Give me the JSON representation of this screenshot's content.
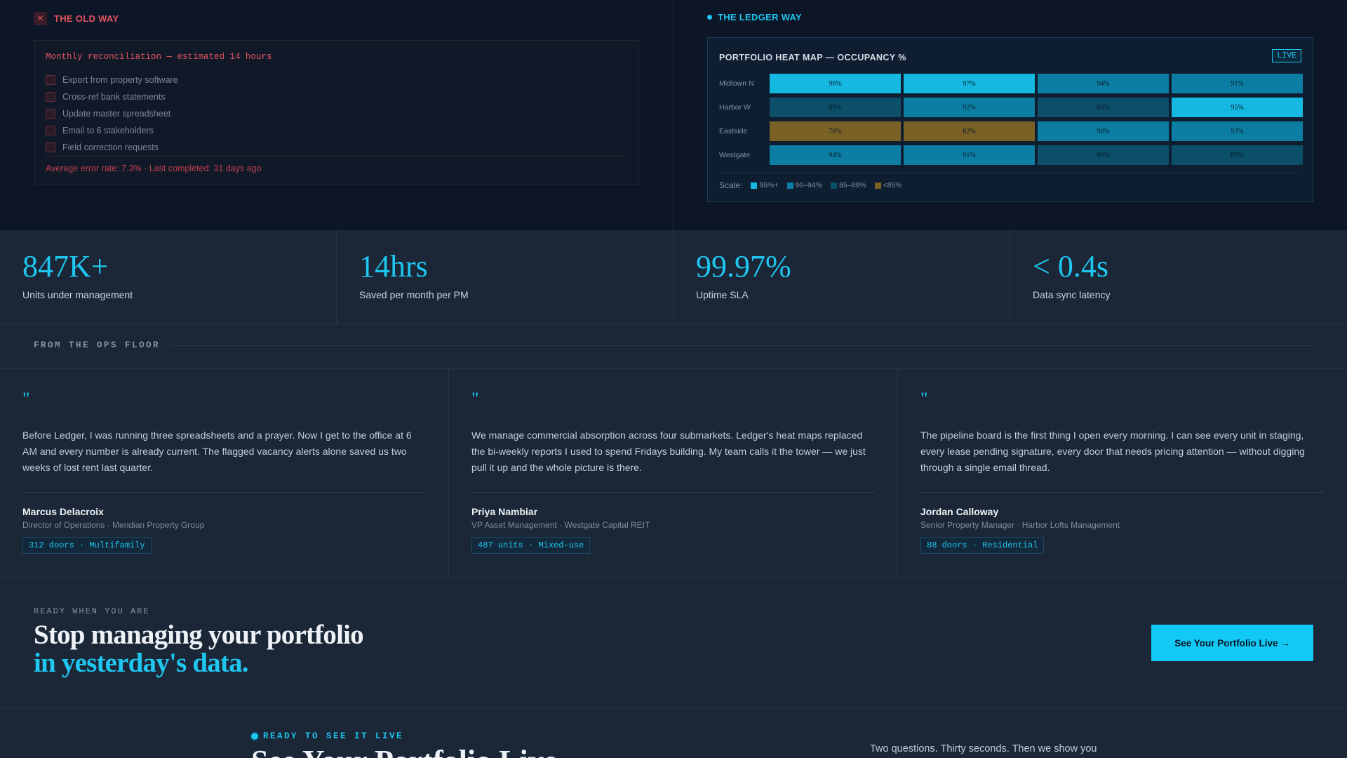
{
  "old_way": {
    "title": "THE OLD WAY",
    "heading": "Monthly reconciliation — estimated 14 hours",
    "tasks": [
      "Export from property software",
      "Cross-ref bank statements",
      "Update master spreadsheet",
      "Email to 6 stakeholders",
      "Field correction requests"
    ],
    "footer": "Average error rate: 7.3% · Last completed: 31 days ago"
  },
  "ledger_way": {
    "title": "THE LEDGER WAY",
    "heatmap_title": "PORTFOLIO HEAT MAP — OCCUPANCY %",
    "live_badge": "LIVE",
    "rows": [
      {
        "label": "Midtown N",
        "cells": [
          "96%",
          "97%",
          "94%",
          "91%"
        ]
      },
      {
        "label": "Harbor W",
        "cells": [
          "89%",
          "92%",
          "88%",
          "95%"
        ]
      },
      {
        "label": "Eastside",
        "cells": [
          "78%",
          "82%",
          "90%",
          "93%"
        ]
      },
      {
        "label": "Westgate",
        "cells": [
          "94%",
          "91%",
          "86%",
          "89%"
        ]
      }
    ],
    "scale_label": "Scale:",
    "scale": [
      {
        "label": "95%+",
        "color": "#14b8e0"
      },
      {
        "label": "90–94%",
        "color": "#0c7ea3"
      },
      {
        "label": "85–89%",
        "color": "#0b4f69"
      },
      {
        "label": "<85%",
        "color": "#7a6226"
      }
    ]
  },
  "stats": [
    {
      "value": "847K+",
      "label": "Units under management"
    },
    {
      "value": "14hrs",
      "label": "Saved per month per PM"
    },
    {
      "value": "99.97%",
      "label": "Uptime SLA"
    },
    {
      "value": "< 0.4s",
      "label": "Data sync latency"
    }
  ],
  "ops_floor": {
    "title": "FROM THE OPS FLOOR",
    "quote_mark": "\"",
    "testimonials": [
      {
        "quote": "Before Ledger, I was running three spreadsheets and a prayer. Now I get to the office at 6 AM and every number is already current. The flagged vacancy alerts alone saved us two weeks of lost rent last quarter.",
        "name": "Marcus Delacroix",
        "role": "Director of Operations · Meridian Property Group",
        "tag": "312 doors · Multifamily"
      },
      {
        "quote": "We manage commercial absorption across four submarkets. Ledger's heat maps replaced the bi-weekly reports I used to spend Fridays building. My team calls it the tower — we just pull it up and the whole picture is there.",
        "name": "Priya Nambiar",
        "role": "VP Asset Management · Westgate Capital REIT",
        "tag": "487 units · Mixed-use"
      },
      {
        "quote": "The pipeline board is the first thing I open every morning. I can see every unit in staging, every lease pending signature, every door that needs pricing attention — without digging through a single email thread.",
        "name": "Jordan Calloway",
        "role": "Senior Property Manager · Harbor Lofts Management",
        "tag": "88 doors · Residential"
      }
    ]
  },
  "cta": {
    "eyebrow": "READY WHEN YOU ARE",
    "line1": "Stop managing your portfolio",
    "line2": "in yesterday's data.",
    "button": "See Your Portfolio Live →"
  },
  "bottom": {
    "eyebrow": "READY TO SEE IT LIVE",
    "title": "See Your Portfolio Live",
    "side_text": "Two questions. Thirty seconds. Then we show you"
  },
  "colors": {
    "accent": "#1ec6f0",
    "danger": "#e0535e",
    "background": "#1b2636",
    "panel_dark": "#0c1627"
  }
}
